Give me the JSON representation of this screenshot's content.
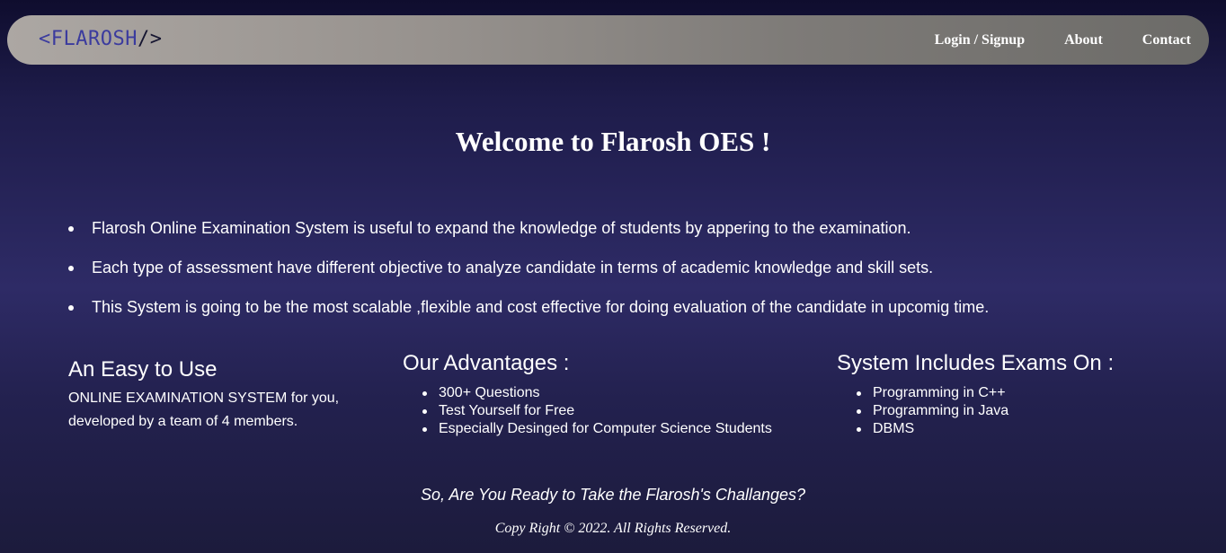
{
  "header": {
    "logo": {
      "open": "<",
      "name": "FLAROSH",
      "close": "/>"
    },
    "nav": [
      {
        "label": "Login / Signup"
      },
      {
        "label": "About"
      },
      {
        "label": "Contact"
      }
    ]
  },
  "main": {
    "welcome": "Welcome to Flarosh OES !",
    "intro": [
      "Flarosh Online Examination System is useful to expand the knowledge of students by appering to the examination.",
      "Each type of assessment have different objective to analyze candidate in terms of academic knowledge and skill sets.",
      "This System is going to be the most scalable ,flexible and cost effective for doing evaluation of the candidate in upcomig time."
    ],
    "easy": {
      "title": "An Easy to Use",
      "text": "ONLINE EXAMINATION SYSTEM for you, developed by a team of 4 members."
    },
    "advantages": {
      "title": "Our Advantages :",
      "items": [
        "300+ Questions",
        "Test Yourself for Free",
        "Especially Desinged for Computer Science Students"
      ]
    },
    "exams": {
      "title": "System Includes Exams On :",
      "items": [
        "Programming in C++",
        "Programming in Java",
        "DBMS"
      ]
    },
    "challenge": "So, Are You Ready to Take the Flarosh's Challanges?"
  },
  "footer": {
    "copyright": "Copy Right © 2022. All Rights Reserved."
  },
  "colors": {
    "background_top": "#0f0d2e",
    "background_mid": "#2e2b66",
    "navbar_left": "#aca7a3",
    "navbar_right": "#6c6b68",
    "logo_accent": "#3b3b9e",
    "text": "#ffffff"
  }
}
